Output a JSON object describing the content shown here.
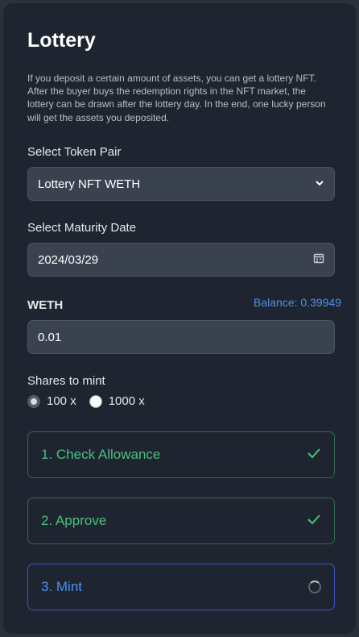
{
  "title": "Lottery",
  "description": "If you deposit a certain amount of assets, you can get a lottery NFT. After the buyer buys the redemption rights in the NFT market, the lottery can be drawn after the lottery day. In the end, one lucky person will get the assets you deposited.",
  "token_pair": {
    "label": "Select Token Pair",
    "selected": "Lottery NFT WETH"
  },
  "maturity": {
    "label": "Select Maturity Date",
    "value": "2024/03/29"
  },
  "amount": {
    "label": "WETH",
    "balance": "Balance: 0.39949",
    "value": "0.01"
  },
  "shares": {
    "label": "Shares to mint",
    "options": [
      "100 x",
      "1000 x"
    ],
    "selected": "100 x"
  },
  "steps": [
    {
      "label": "1. Check Allowance",
      "status": "done"
    },
    {
      "label": "2. Approve",
      "status": "done"
    },
    {
      "label": "3. Mint",
      "status": "loading"
    }
  ],
  "colors": {
    "accent": "#4f8ff0",
    "success": "#48c07a",
    "card_bg": "#1e2530",
    "field_bg": "#3a4250"
  },
  "icons": [
    "chevron-down-icon",
    "calendar-icon",
    "check-icon",
    "spinner-icon"
  ]
}
